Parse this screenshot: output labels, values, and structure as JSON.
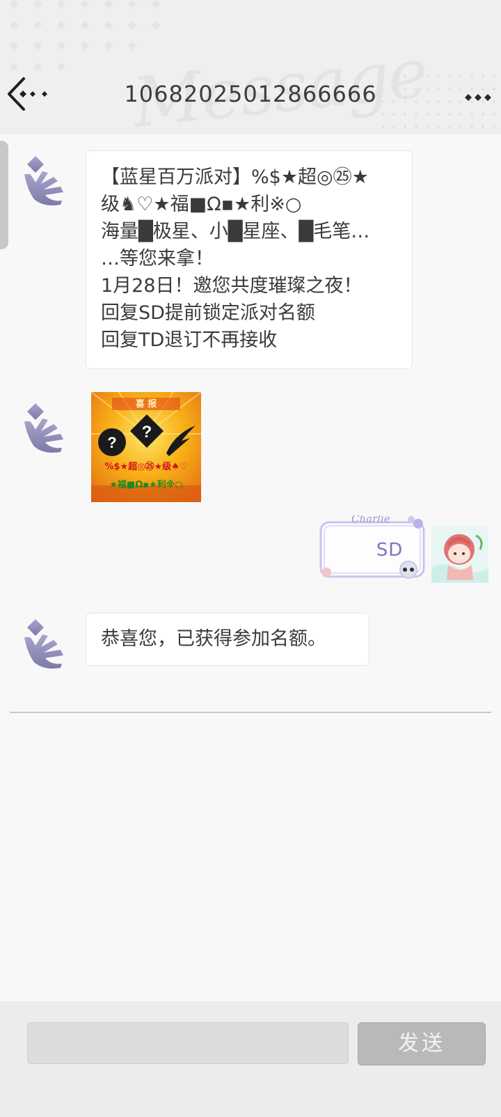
{
  "header": {
    "title": "10682025012866666",
    "watermark": "Message"
  },
  "messages": {
    "incoming_1": {
      "lines": [
        "【蓝星百万派对】%$★超◎㉕★",
        "级♞♡★福■Ω▪★利※○",
        "海量█极星、小█星座、█毛笔…",
        "…等您来拿！",
        "1月28日！邀您共度璀璨之夜！",
        "回复SD提前锁定派对名额",
        "回复TD退订不再接收"
      ]
    },
    "incoming_image": {
      "banner": "喜 报",
      "row1": "%$★超◎㉕★级♠♡",
      "row2": "★福■Ω▪★利※○"
    },
    "outgoing_1": {
      "text": "SD",
      "sticker_name": "Charlie"
    },
    "incoming_2": {
      "text": "恭喜您，已获得参加名额。"
    }
  },
  "compose": {
    "input_value": "",
    "send_label": "发送"
  },
  "colors": {
    "header_bg": "#efefef",
    "page_bg": "#f8f8f8",
    "send_button_bg": "#b9b9b9",
    "avatar_color": "#8d8ab8"
  },
  "icons": {
    "back": "back-arrow-icon",
    "more": "more-dots-icon",
    "avatar": "crystal-wing-icon"
  }
}
